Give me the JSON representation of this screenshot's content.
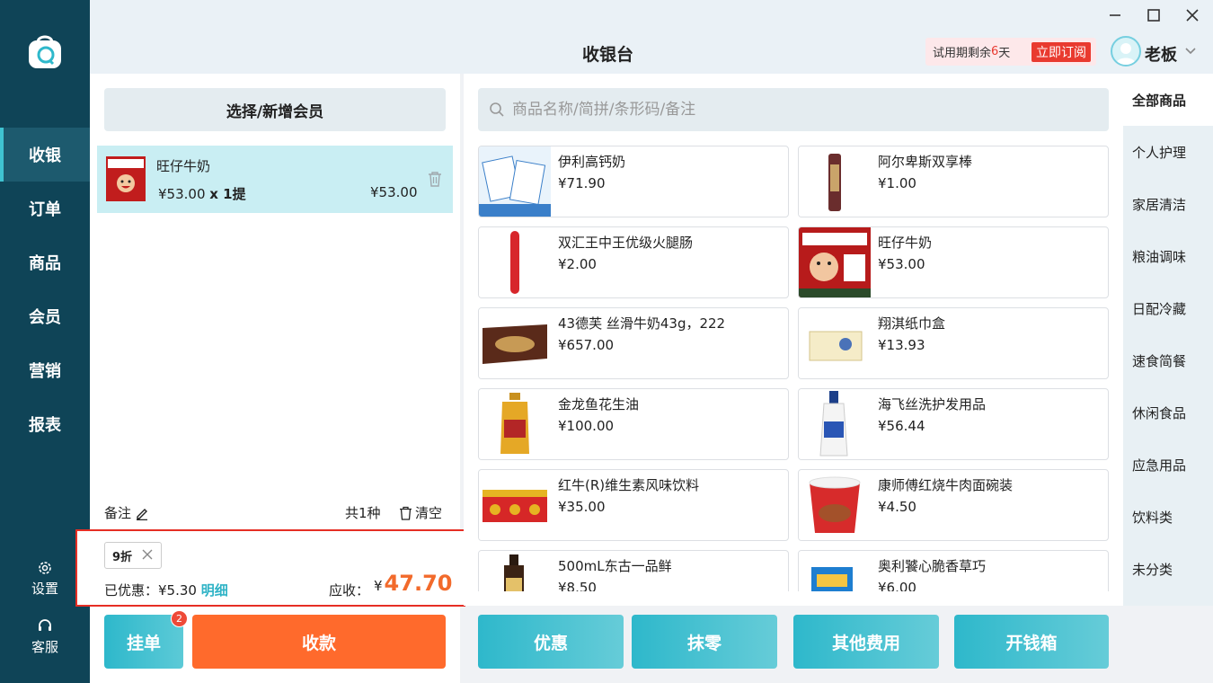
{
  "app": {
    "title": "收银台"
  },
  "window": {
    "minimize_icon": "minimize-icon",
    "maximize_icon": "maximize-icon",
    "close_icon": "close-icon"
  },
  "header": {
    "trial_prefix": "试用期剩余",
    "trial_days": "6",
    "trial_unit": "天",
    "subscribe_label": "立即订阅",
    "user_name": "老板"
  },
  "sidebar": {
    "items": [
      {
        "label": "收银",
        "active": true
      },
      {
        "label": "订单"
      },
      {
        "label": "商品"
      },
      {
        "label": "会员"
      },
      {
        "label": "营销"
      },
      {
        "label": "报表"
      }
    ],
    "settings_label": "设置",
    "support_label": "客服"
  },
  "cart": {
    "member_button": "选择/新增会员",
    "items": [
      {
        "name": "旺仔牛奶",
        "unit_price": "¥53.00",
        "qty": "x 1提",
        "subtotal": "¥53.00"
      }
    ],
    "remark_label": "备注",
    "count_label": "共1种",
    "clear_label": "清空",
    "discount_tag": "9折",
    "saved_label": "已优惠：",
    "saved_value": "¥5.30",
    "detail_link": "明细",
    "due_label": "应收：",
    "due_currency": "¥",
    "due_value": "47.70",
    "hold_label": "挂单",
    "hold_count": "2",
    "pay_label": "收款"
  },
  "search": {
    "placeholder": "商品名称/简拼/条形码/备注"
  },
  "products": [
    {
      "name": "伊利高钙奶",
      "price": "¥71.90"
    },
    {
      "name": "阿尔卑斯双享棒",
      "price": "¥1.00"
    },
    {
      "name": "双汇王中王优级火腿肠",
      "price": "¥2.00"
    },
    {
      "name": "旺仔牛奶",
      "price": "¥53.00"
    },
    {
      "name": "43德芙 丝滑牛奶43g，222",
      "price": "¥657.00"
    },
    {
      "name": "翔淇纸巾盒",
      "price": "¥13.93"
    },
    {
      "name": "金龙鱼花生油",
      "price": "¥100.00"
    },
    {
      "name": "海飞丝洗护发用品",
      "price": "¥56.44"
    },
    {
      "name": "红牛(R)维生素风味饮料",
      "price": "¥35.00"
    },
    {
      "name": "康师傅红烧牛肉面碗装",
      "price": "¥4.50"
    },
    {
      "name": "500mL东古一品鲜",
      "price": "¥8.50"
    },
    {
      "name": "奥利饕心脆香草巧",
      "price": "¥6.00"
    }
  ],
  "categories": [
    {
      "label": "全部商品",
      "active": true
    },
    {
      "label": "个人护理"
    },
    {
      "label": "家居清洁"
    },
    {
      "label": "粮油调味"
    },
    {
      "label": "日配冷藏"
    },
    {
      "label": "速食简餐"
    },
    {
      "label": "休闲食品"
    },
    {
      "label": "应急用品"
    },
    {
      "label": "饮料类"
    },
    {
      "label": "未分类"
    }
  ],
  "actions": [
    {
      "label": "优惠"
    },
    {
      "label": "抹零"
    },
    {
      "label": "其他费用"
    },
    {
      "label": "开钱箱"
    }
  ],
  "colors": {
    "sidebar": "#0f4457",
    "accent": "#2eb8cb",
    "pay": "#ff6a2c",
    "due": "#f26a2b",
    "highlight_border": "#e62e24"
  }
}
